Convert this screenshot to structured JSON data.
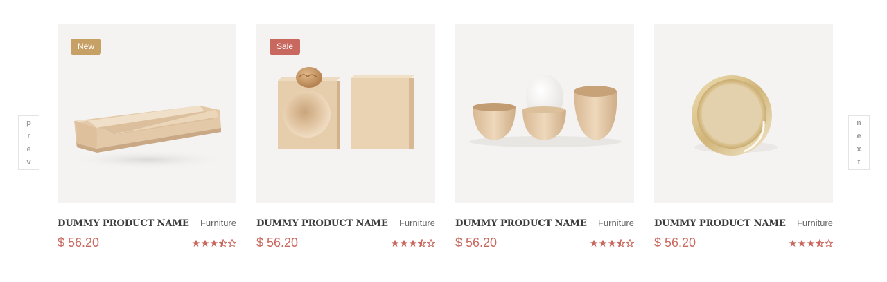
{
  "navigation": {
    "prev_label": [
      "p",
      "r",
      "e",
      "v"
    ],
    "next_label": [
      "n",
      "e",
      "x",
      "t"
    ]
  },
  "colors": {
    "price": "#c9685e",
    "star": "#c9685e",
    "badge_new": "#c7a065",
    "badge_sale": "#c9685e",
    "card_background": "#f4f3f2"
  },
  "products": [
    {
      "name": "DUMMY PRODUCT NAME",
      "category": "Furniture",
      "price": "$ 56.20",
      "badge": "New",
      "rating": 3.5,
      "image": "wooden-pen-tray"
    },
    {
      "name": "DUMMY PRODUCT NAME",
      "category": "Furniture",
      "price": "$ 56.20",
      "badge": "Sale",
      "rating": 3.5,
      "image": "wooden-cube-nutcracker"
    },
    {
      "name": "DUMMY PRODUCT NAME",
      "category": "Furniture",
      "price": "$ 56.20",
      "badge": "",
      "rating": 3.5,
      "image": "wooden-egg-cups"
    },
    {
      "name": "DUMMY PRODUCT NAME",
      "category": "Furniture",
      "price": "$ 56.20",
      "badge": "",
      "rating": 3.5,
      "image": "brass-ring-dish"
    }
  ]
}
